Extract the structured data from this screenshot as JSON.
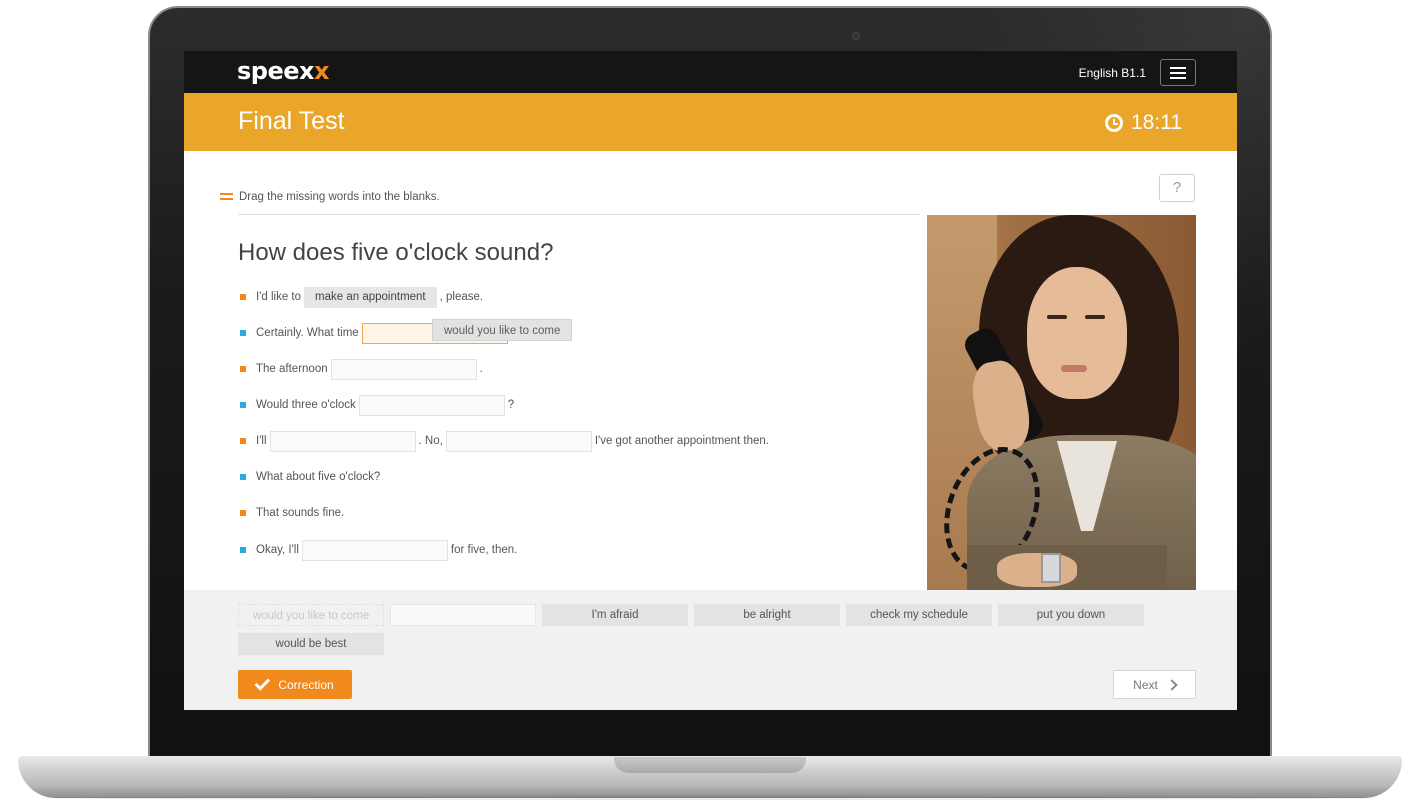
{
  "app": {
    "logo_main": "speex",
    "logo_accent": "x",
    "course": "English B1.1"
  },
  "header": {
    "title": "Final Test",
    "timer": "18:11"
  },
  "exercise": {
    "instruction": "Drag the missing words into the blanks.",
    "help": "?",
    "heading": "How does five o'clock sound?",
    "lines": [
      {
        "speaker": "orange",
        "before": "I'd like to",
        "filled": "make an appointment",
        "after": ", please."
      },
      {
        "speaker": "blue",
        "before": "Certainly. What time",
        "after": ""
      },
      {
        "speaker": "orange",
        "before": "The afternoon",
        "after": "."
      },
      {
        "speaker": "blue",
        "before": "Would three o'clock",
        "after": "?"
      },
      {
        "speaker": "orange",
        "before": "I'll",
        "middle": ". No,",
        "after": "I've got another appointment then."
      },
      {
        "speaker": "blue",
        "before": "What about five o'clock?"
      },
      {
        "speaker": "orange",
        "before": "That sounds fine."
      },
      {
        "speaker": "blue",
        "before": "Okay, I'll",
        "after": "for five, then."
      }
    ],
    "dragging_chip": "would you like to come"
  },
  "word_bank": {
    "chips": [
      "would you like to come",
      "",
      "I'm afraid",
      "be alright",
      "check my schedule",
      "put you down",
      "would be best"
    ]
  },
  "footer": {
    "correction": "Correction",
    "next": "Next"
  },
  "colors": {
    "accent_orange": "#f08a1c",
    "header_yellow": "#e9a62a",
    "bullet_blue": "#27a9e1"
  }
}
